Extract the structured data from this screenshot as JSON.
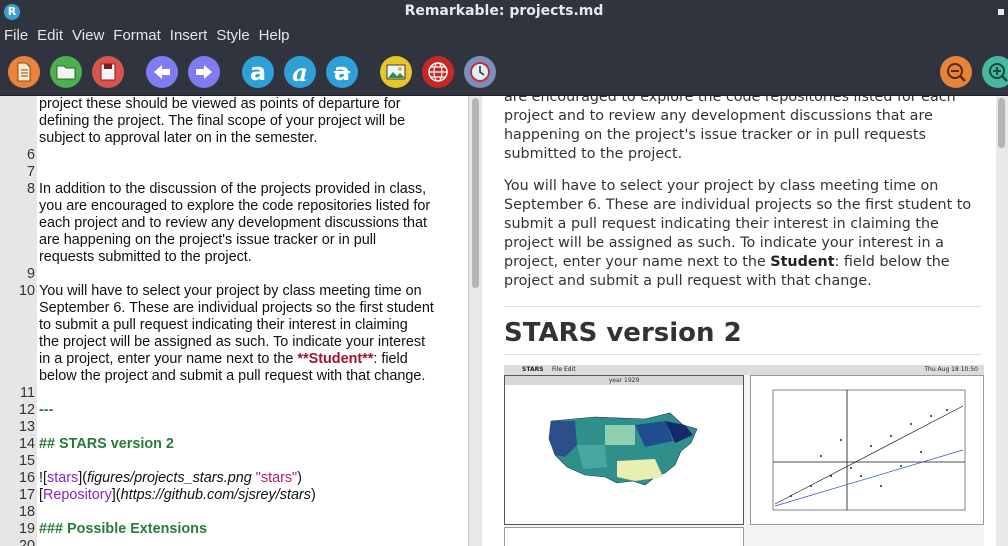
{
  "window": {
    "title": "Remarkable: projects.md",
    "app_icon_letter": "R"
  },
  "menu": [
    "File",
    "Edit",
    "View",
    "Format",
    "Insert",
    "Style",
    "Help"
  ],
  "toolbar": {
    "buttons": [
      "new-document",
      "open-file",
      "save",
      "undo",
      "redo",
      "bold",
      "italic",
      "strikethrough",
      "insert-image",
      "insert-link",
      "insert-timestamp",
      "zoom-out",
      "zoom-in"
    ],
    "bold_glyph": "a",
    "italic_glyph": "a",
    "strike_glyph": "a",
    "colors": {
      "new": "#e8833a",
      "open": "#4caf50",
      "save": "#d9534f",
      "nav": "#7e7cf0",
      "format": "#2f9fd8",
      "image": "#e8c62a",
      "link": "#c62828",
      "time": "#7a8fc0",
      "zoom_out": "#e8833a",
      "zoom_in": "#4ab6a0"
    }
  },
  "editor": {
    "lines": [
      {
        "num": "",
        "text": "project these should be viewed as points of departure for"
      },
      {
        "num": "",
        "text": "defining the project.  The final scope of your project will be"
      },
      {
        "num": "",
        "text": "subject to approval later on in the semester."
      },
      {
        "num": "6",
        "text": ""
      },
      {
        "num": "7",
        "text": ""
      },
      {
        "num": "8",
        "text": "In addition to the discussion of the projects provided in class,"
      },
      {
        "num": "",
        "text": "you are encouraged to explore the code repositories listed for"
      },
      {
        "num": "",
        "text": "each project and to review any development discussions that"
      },
      {
        "num": "",
        "text": "are happening on the project's issue tracker or in pull"
      },
      {
        "num": "",
        "text": "requests submitted to the project."
      },
      {
        "num": "9",
        "text": ""
      },
      {
        "num": "10",
        "text": "You will have to select your project by class meeting time on"
      },
      {
        "num": "",
        "text": "September 6. These are individual projects so the first student"
      },
      {
        "num": "",
        "text": "to submit a pull request indicating their interest in claiming"
      },
      {
        "num": "",
        "text": "the project will be assigned as such. To indicate your interest"
      },
      {
        "num": "",
        "pre": "in a project, enter your name next to the ",
        "bold": "**Student**",
        "post": ": field"
      },
      {
        "num": "",
        "text": "below the project and submit a pull request with that change."
      },
      {
        "num": "11",
        "text": ""
      },
      {
        "num": "12",
        "hr": "---"
      },
      {
        "num": "13",
        "text": ""
      },
      {
        "num": "14",
        "heading": "## STARS version 2"
      },
      {
        "num": "15",
        "text": ""
      },
      {
        "num": "16",
        "img": {
          "bang": "!",
          "lb": "[",
          "alt": "stars",
          "rb": "]",
          "lp": "(",
          "url": "figures/projects_stars.png",
          "sp": " ",
          "title": "\"stars\"",
          "rp": ")"
        }
      },
      {
        "num": "17",
        "link": {
          "lb": "[",
          "text": "Repository",
          "rb": "]",
          "lp": "(",
          "url": "https://github.com/sjsrey/stars",
          "rp": ")"
        }
      },
      {
        "num": "18",
        "text": ""
      },
      {
        "num": "19",
        "heading": "### Possible Extensions"
      },
      {
        "num": "20",
        "text": ""
      }
    ]
  },
  "preview": {
    "para1": [
      "are encouraged to explore the code repositories listed for each",
      "project and to review any development discussions that are",
      "happening on the project's issue tracker or in pull requests",
      "submitted to the project."
    ],
    "para2": [
      "You will have to select your project by class meeting time on",
      "September 6. These are individual projects so the first student to",
      "submit a pull request indicating their interest in claiming the",
      "project will be assigned as such. To indicate your interest in a"
    ],
    "para2_line5_pre": "project, enter your name next to the ",
    "para2_line5_bold": "Student",
    "para2_line5_post": ": field below the",
    "para2_line6": "project and submit a pull request with that change.",
    "heading": "STARS version 2",
    "image": {
      "menubar_app": "STARS",
      "menubar_items": "File   Edit",
      "menubar_clock": "Thu Aug 18  10:50",
      "map_window_title": "year 1929"
    }
  }
}
